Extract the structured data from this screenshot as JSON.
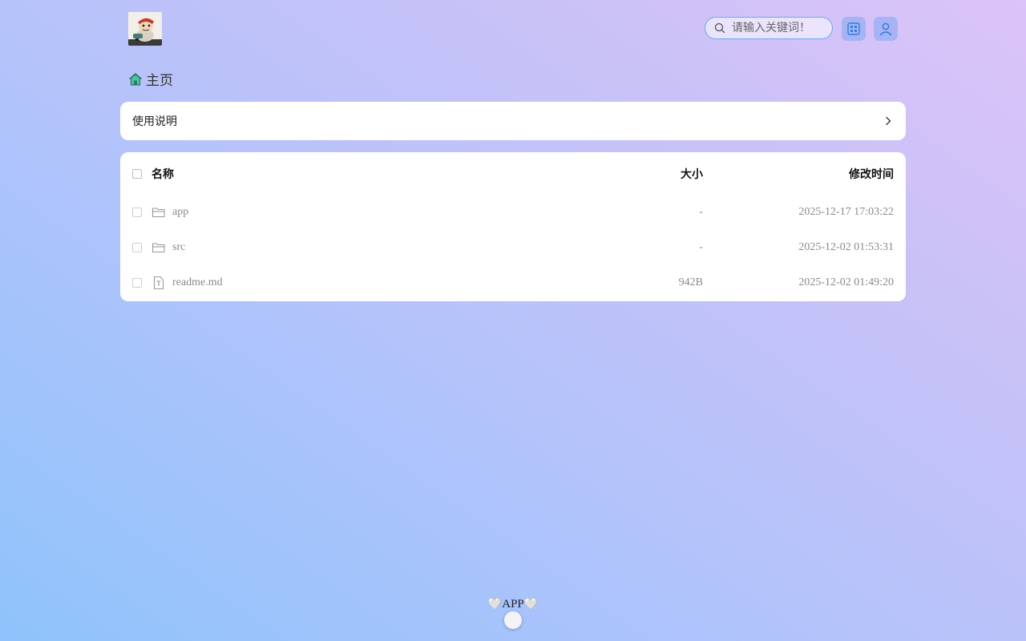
{
  "header": {
    "logo": "pirate-avatar-logo",
    "search": {
      "placeholder": "请输入关键词！",
      "value": ""
    },
    "buttons": [
      {
        "icon": "grid-icon"
      },
      {
        "icon": "user-icon"
      }
    ]
  },
  "breadcrumb": {
    "icon": "home-icon",
    "label": "主页"
  },
  "readme_bar": {
    "label": "使用说明",
    "icon": "chevron-right-icon"
  },
  "table": {
    "columns": {
      "name": "名称",
      "size": "大小",
      "modified": "修改时间"
    },
    "rows": [
      {
        "icon": "folder-icon",
        "name": "app",
        "size": "-",
        "modified": "2025-12-17 17:03:22"
      },
      {
        "icon": "folder-icon",
        "name": "src",
        "size": "-",
        "modified": "2025-12-02 01:53:31"
      },
      {
        "icon": "text-file-icon",
        "name": "readme.md",
        "size": "942B",
        "modified": "2025-12-02 01:49:20"
      }
    ]
  },
  "footer": {
    "label": "APP",
    "left_glyph": "🤍",
    "right_glyph": "🤍"
  },
  "colors": {
    "accent": "#6aa9ee",
    "panel": "#ffffff",
    "muted_text": "#8a8a8a"
  }
}
